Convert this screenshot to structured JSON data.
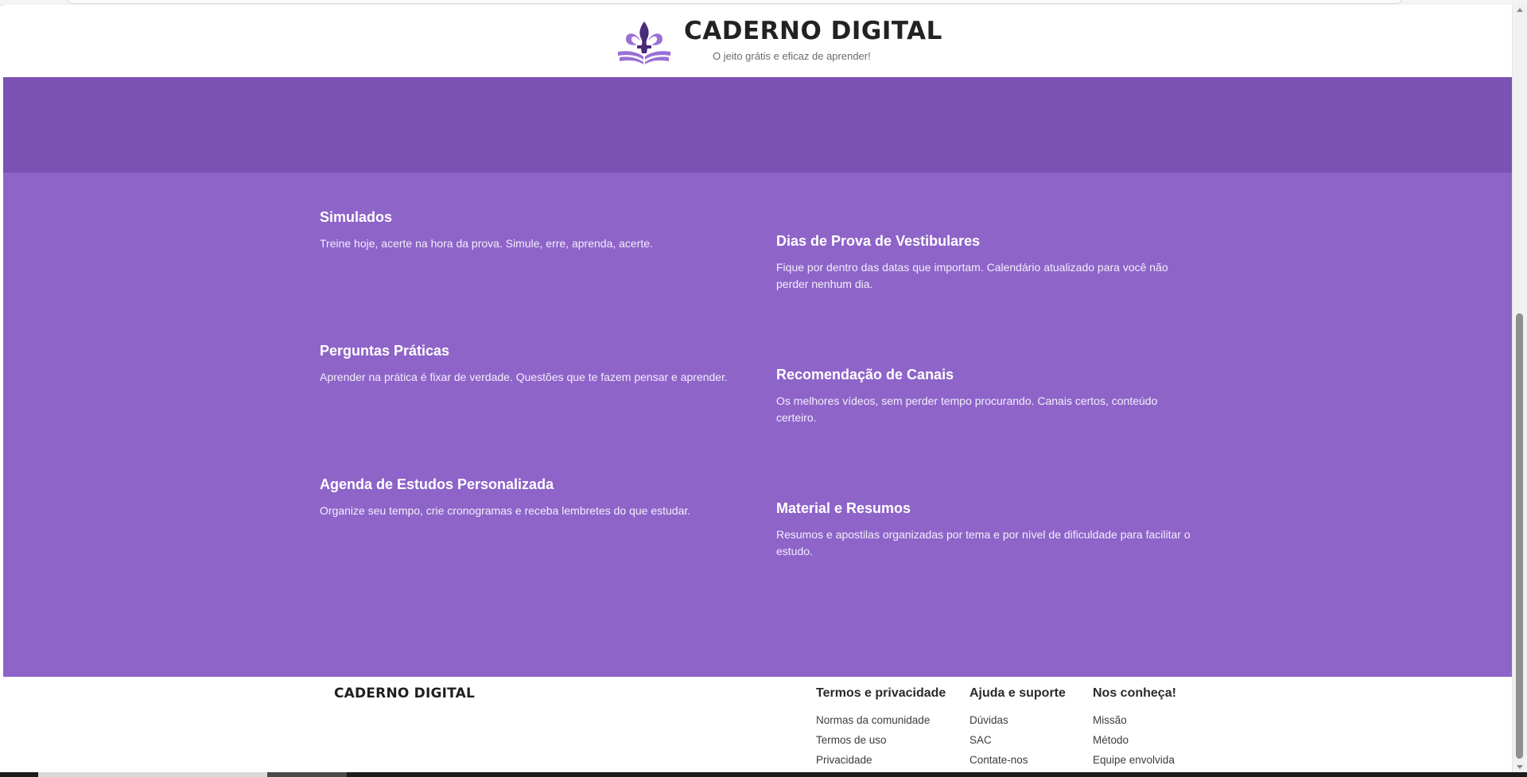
{
  "header": {
    "brand_title": "CADERNO DIGITAL",
    "tagline": "O jeito grátis e eficaz de aprender!",
    "logo_icon": "fleur-de-lis-book-icon"
  },
  "features": [
    {
      "title": "Simulados",
      "description": "Treine hoje, acerte na hora da prova. Simule, erre, aprenda, acerte."
    },
    {
      "title": "Dias de Prova de Vestibulares",
      "description": "Fique por dentro das datas que importam. Calendário atualizado para você não perder nenhum dia."
    },
    {
      "title": "Perguntas Práticas",
      "description": "Aprender na prática é fixar de verdade. Questões que te fazem pensar e aprender."
    },
    {
      "title": "Recomendação de Canais",
      "description": "Os melhores vídeos, sem perder tempo procurando. Canais certos, conteúdo certeiro."
    },
    {
      "title": "Agenda de Estudos Personalizada",
      "description": "Organize seu tempo, crie cronogramas e receba lembretes do que estudar."
    },
    {
      "title": "Material e Resumos",
      "description": "Resumos e apostilas organizadas por tema e por nível de dificuldade para facilitar o estudo."
    }
  ],
  "footer": {
    "brand": "CADERNO DIGITAL",
    "columns": [
      {
        "heading": "Termos e privacidade",
        "links": [
          "Normas da comunidade",
          "Termos de uso",
          "Privacidade"
        ]
      },
      {
        "heading": "Ajuda e suporte",
        "links": [
          "Dúvidas",
          "SAC",
          "Contate-nos"
        ]
      },
      {
        "heading": "Nos conheça!",
        "links": [
          "Missão",
          "Método",
          "Equipe envolvida"
        ]
      }
    ]
  },
  "colors": {
    "hero_band": "#7b51b3",
    "features_bg": "#8e64c9",
    "logo_dark": "#4a2a7a",
    "logo_light": "#9a6fd6"
  }
}
